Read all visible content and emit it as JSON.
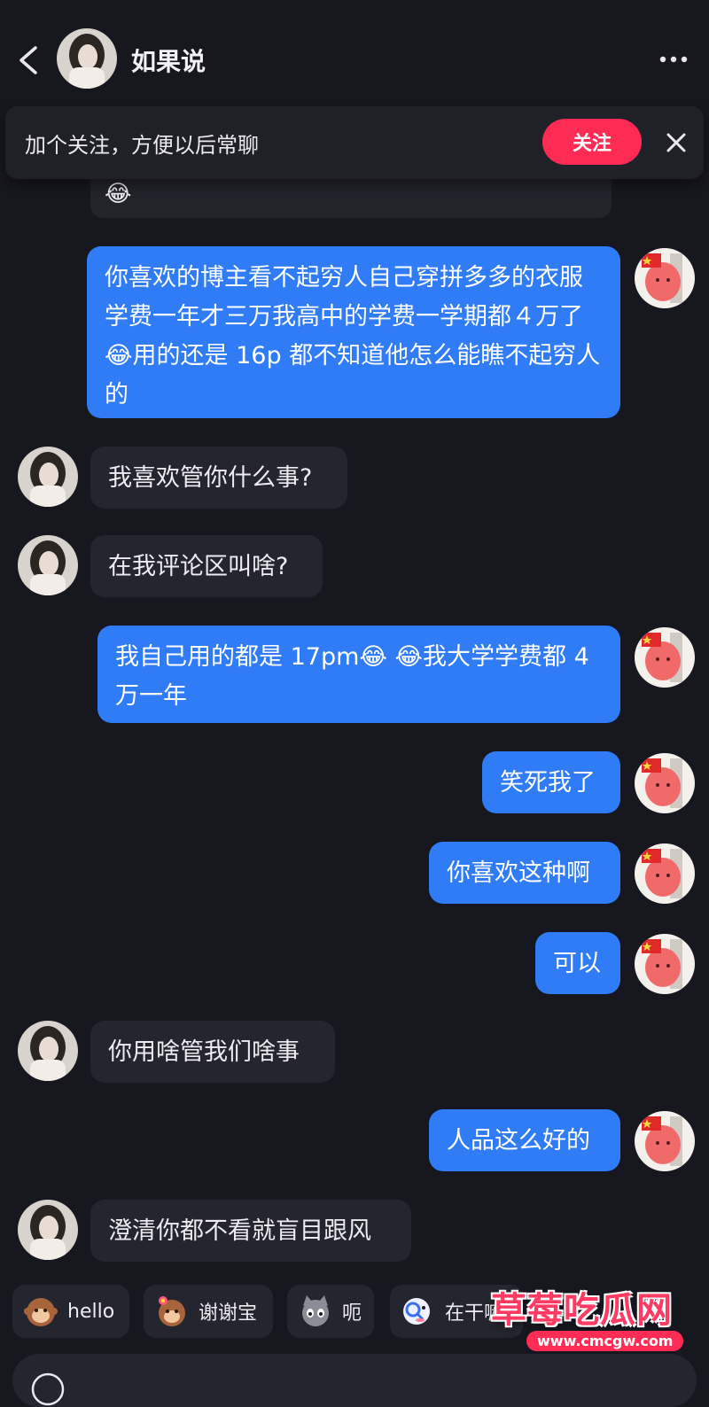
{
  "header": {
    "contact_name": "如果说"
  },
  "follow_banner": {
    "text": "加个关注，方便以后常聊",
    "button_label": "关注"
  },
  "messages": [
    {
      "side": "in",
      "text": "😂",
      "partial": true
    },
    {
      "side": "out",
      "text": "你喜欢的博主看不起穷人自己穿拼多多的衣服学费一年才三万我高中的学费一学期都４万了😂用的还是 16p 都不知道他怎么能瞧不起穷人的"
    },
    {
      "side": "in",
      "text": "我喜欢管你什么事?"
    },
    {
      "side": "in",
      "text": "在我评论区叫啥?"
    },
    {
      "side": "out",
      "text": "我自己用的都是 17pm😂 😂我大学学费都 4万一年"
    },
    {
      "side": "out",
      "text": "笑死我了"
    },
    {
      "side": "out",
      "text": "你喜欢这种啊"
    },
    {
      "side": "out",
      "text": "可以"
    },
    {
      "side": "in",
      "text": "你用啥管我们啥事"
    },
    {
      "side": "out",
      "text": "人品这么好的"
    },
    {
      "side": "in",
      "text": "澄清你都不看就盲目跟风"
    }
  ],
  "quick_replies": [
    {
      "label": "hello",
      "icon": "monkey-icon"
    },
    {
      "label": "谢谢宝",
      "icon": "monkey-flower-icon"
    },
    {
      "label": "呃",
      "icon": "cat-icon"
    },
    {
      "label": "在干嘛",
      "icon": "magnifier-face-icon"
    }
  ],
  "watermark": {
    "title": "草莓吃瓜网",
    "url": "www.cmcgw.com"
  },
  "colors": {
    "background": "#17171f",
    "incoming_bubble": "#25252f",
    "outgoing_bubble": "#2f7cf6",
    "follow_button": "#fe2c55"
  }
}
